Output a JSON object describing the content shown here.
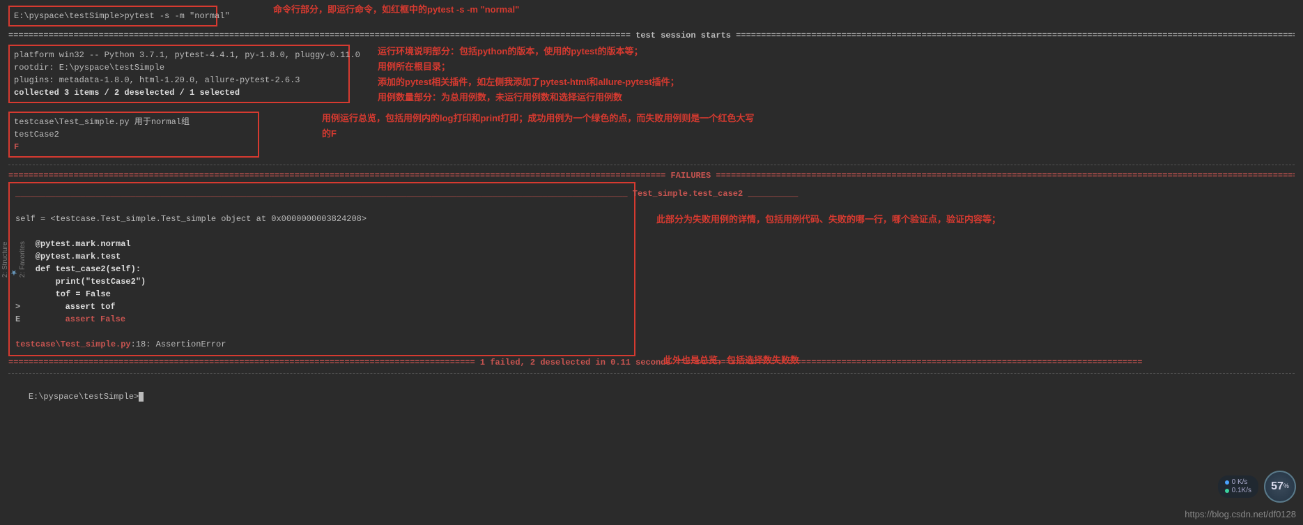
{
  "cmd": {
    "prompt": "E:\\pyspace\\testSimple>",
    "command": "pytest -s -m \"normal\""
  },
  "anno": {
    "cmd": "命令行部分，即运行命令，如红框中的pytest -s -m \"normal\"",
    "env1": "运行环境说明部分：包括python的版本，使用的pytest的版本等；",
    "env2": "用例所在根目录；",
    "env3": "添加的pytest相关插件，如左侧我添加了pytest-html和allure-pytest插件；",
    "env4": "用例数量部分：为总用例数，未运行用例数和选择运行用例数",
    "run1": "用例运行总览，包括用例内的log打印和print打印；成功用例为一个绿色的点，而失败用例则是一个红色大写",
    "run2": "的F",
    "fail": "此部分为失败用例的详情，包括用例代码、失败的哪一行，哪个验证点，验证内容等；",
    "summary": "此外也是总览，包括选择数失败数"
  },
  "session": {
    "rule": "============================================================================================================================ test session starts ============================================================================================================================",
    "platform": "platform win32 -- Python 3.7.1, pytest-4.4.1, py-1.8.0, pluggy-0.11.0",
    "rootdir": "rootdir: E:\\pyspace\\testSimple",
    "plugins": "plugins: metadata-1.8.0, html-1.20.0, allure-pytest-2.6.3",
    "collected": "collected 3 items / 2 deselected / 1 selected"
  },
  "run": {
    "line1": "testcase\\Test_simple.py 用于normal组",
    "line2": "testCase2",
    "line3": "F"
  },
  "failures": {
    "rule": "=================================================================================================================================== FAILURES ===================================================================================================================================",
    "title": "__________________________________________________________________________________________________________________________ Test_simple.test_case2 __________",
    "self": "self = <testcase.Test_simple.Test_simple object at 0x0000000003824208>",
    "l1": "    @pytest.mark.normal",
    "l2": "    @pytest.mark.test",
    "l3": "    def test_case2(self):",
    "l4": "        print(\"testCase2\")",
    "l5": "        tof = False",
    "l6": "        assert tof",
    "l7": "        assert False",
    "err_mark": ">",
    "err_E": "E",
    "loc": "testcase\\Test_simple.py",
    "loc_rest": ":18: AssertionError"
  },
  "summary": {
    "rule_left": "============================================================================================= ",
    "text": "1 failed, 2 deselected in 0.11 seconds",
    "rule_right": " ============================================================================================="
  },
  "footer_prompt": "E:\\pyspace\\testSimple>",
  "watermark": "https://blog.csdn.net/df0128",
  "net": {
    "up": "0 K/s",
    "down": "0.1K/s",
    "pct": "57",
    "pct_unit": "%"
  },
  "side": {
    "structure": "2: Structure",
    "favorites": "2: Favorites"
  }
}
